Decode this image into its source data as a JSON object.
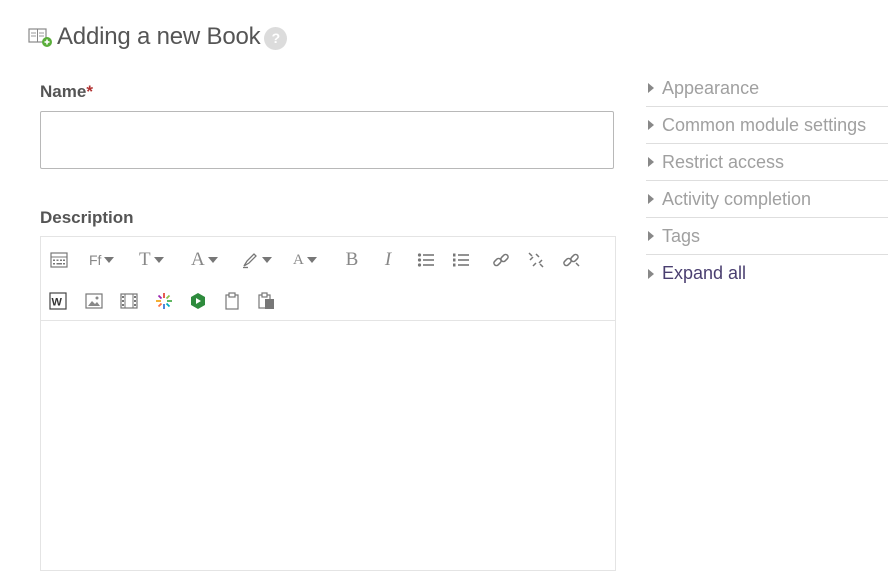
{
  "header": {
    "title": "Adding a new Book",
    "help_icon_text": "?"
  },
  "form": {
    "name_label": "Name",
    "required_marker": "*",
    "name_value": "",
    "description_label": "Description"
  },
  "editor": {
    "toolbar_row1": [
      {
        "name": "toolbar-toggle-icon"
      },
      {
        "name": "font-family-button",
        "text": "Ff"
      },
      {
        "name": "font-size-button",
        "text": "T"
      },
      {
        "name": "font-color-button",
        "text": "A"
      },
      {
        "name": "background-color-button"
      },
      {
        "name": "styles-button",
        "text": "A"
      },
      {
        "name": "bold-button",
        "text": "B"
      },
      {
        "name": "italic-button",
        "text": "I"
      },
      {
        "name": "unordered-list-icon"
      },
      {
        "name": "ordered-list-icon"
      },
      {
        "name": "link-icon"
      },
      {
        "name": "unlink-icon"
      },
      {
        "name": "anchor-link-icon"
      }
    ],
    "toolbar_row2": [
      {
        "name": "word-paste-icon",
        "text": "W"
      },
      {
        "name": "insert-image-icon"
      },
      {
        "name": "insert-media-icon"
      },
      {
        "name": "h5p-icon"
      },
      {
        "name": "recording-icon"
      },
      {
        "name": "paste-icon"
      },
      {
        "name": "paste-special-icon"
      }
    ]
  },
  "sidebar": {
    "sections": [
      {
        "label": "Appearance"
      },
      {
        "label": "Common module settings"
      },
      {
        "label": "Restrict access"
      },
      {
        "label": "Activity completion"
      },
      {
        "label": "Tags"
      }
    ],
    "expand_all": "Expand all"
  },
  "colors": {
    "accent_link": "#4a3f70",
    "required": "#b03030",
    "muted_text": "#a0a0a0"
  }
}
